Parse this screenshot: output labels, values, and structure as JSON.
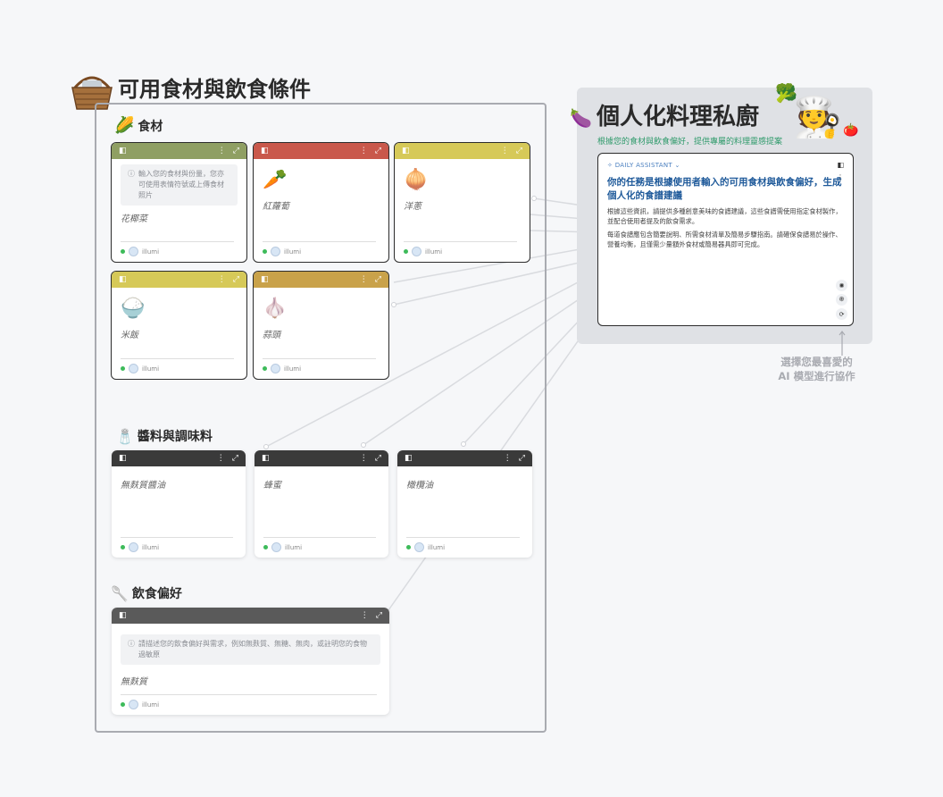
{
  "group": {
    "title": "可用食材與飲食條件",
    "icon": "basket-icon"
  },
  "sections": {
    "ingredients": "食材",
    "sauces": "醬料與調味料",
    "diet": "飲食偏好"
  },
  "ingredient_hint": "輸入您的食材與份量，您亦可使用表情符號或上傳食材照片",
  "ingredients": [
    {
      "emoji": "",
      "label": "花椰菜",
      "color": "#8f9f63"
    },
    {
      "emoji": "🥕",
      "label": "紅蘿蔔",
      "color": "#c9584b"
    },
    {
      "emoji": "🧅",
      "label": "洋蔥",
      "color": "#d6c958"
    },
    {
      "emoji": "🍚",
      "label": "米飯",
      "color": "#d6c958"
    },
    {
      "emoji": "🧄",
      "label": "蒜頭",
      "color": "#c9a24a"
    }
  ],
  "sauces": [
    {
      "label": "無麩質醬油"
    },
    {
      "label": "蜂蜜"
    },
    {
      "label": "橄欖油"
    }
  ],
  "diet": {
    "hint": "請描述您的飲食偏好與需求，例如無麩質、無糖、無肉，或註明您的食物過敏原",
    "value": "無麩質"
  },
  "footer_user": "illumi",
  "right": {
    "title": "個人化料理私廚",
    "subtitle": "根據您的食材與飲食偏好，提供專屬的料理靈感提案",
    "assistant_tag": "DAILY ASSISTANT",
    "heading": "你的任務是根據使用者輸入的可用食材與飲食偏好，生成個人化的食譜建議",
    "p1": "根據這些資訊，請提供多種創意美味的食譜建議，這些食譜需使用指定食材製作，並配合使用者提及的飲食需求。",
    "p2": "每道食譜應包含簡要說明、所需食材清單及簡易步驟指南。請確保食譜易於操作、營養均衡，且僅需少量額外食材或簡易器具即可完成。"
  },
  "caption": "選擇您最喜愛的\nAI 模型進行協作",
  "colors": {
    "dark_header": "#3a3a3a",
    "accent_green": "#2f9a6b",
    "accent_blue": "#1f5a9a"
  }
}
